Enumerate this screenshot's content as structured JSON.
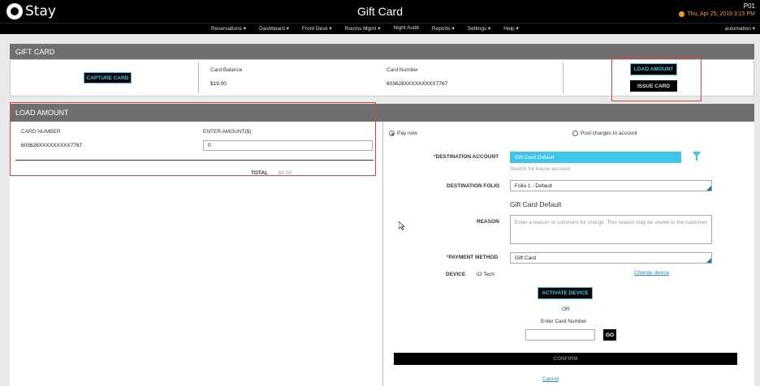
{
  "app": {
    "logo_text": "Stay",
    "title": "Gift Card",
    "hotel_code": "P01",
    "datetime": "Thu, Apr 25, 2019 3:15 PM"
  },
  "nav": {
    "items": [
      "Reservations ▾",
      "Dashboard ▾",
      "Front Desk ▾",
      "Rooms Mgmt ▾",
      "Night Audit",
      "Reports ▾",
      "Settings ▾",
      "Help ▾"
    ],
    "user": "automation"
  },
  "gift_card": {
    "header": "GIFT CARD",
    "capture_label": "CAPTURE CARD",
    "balance_label": "Card Balance",
    "balance_value": "$19.00",
    "number_label": "Card Number",
    "number_value": "603628XXXXXXXXX7767",
    "load_amount_label": "LOAD AMOUNT",
    "issue_card_label": "ISSUE CARD"
  },
  "load_amount": {
    "header": "LOAD AMOUNT",
    "card_number_label": "CARD NUMBER",
    "card_number_value": "603628XXXXXXXXX7767",
    "enter_amount_label": "ENTER AMOUNT($)",
    "amount_value": "0",
    "total_label": "TOTAL",
    "total_value": "$0.00"
  },
  "payment": {
    "pay_now_label": "Pay now",
    "post_charges_label": "Post charges to account",
    "destination_account_label": "DESTINATION ACCOUNT",
    "destination_account_value": "Gift Card Default",
    "search_house_placeholder": "Search for house account",
    "destination_folio_label": "DESTINATION FOLIO",
    "destination_folio_value": "Folio 1 - Default",
    "account_name": "Gift Card Default",
    "reason_label": "REASON",
    "reason_placeholder": "Enter a reason or comment for charge. This reason may be visible to the customer.",
    "payment_method_label": "PAYMENT METHOD",
    "payment_method_value": "Gift Card",
    "device_label": "DEVICE",
    "device_value": "iO Tech",
    "change_device_label": "Change device",
    "activate_device_label": "ACTIVATE DEVICE",
    "or_label": "OR",
    "enter_card_number_label": "Enter Card Number",
    "go_label": "GO",
    "confirm_label": "CONFIRM",
    "cancel_label": "Cancel"
  },
  "colors": {
    "accent": "#3ec5ea",
    "highlight": "#e04040",
    "header_gray": "#6f6f6f"
  }
}
